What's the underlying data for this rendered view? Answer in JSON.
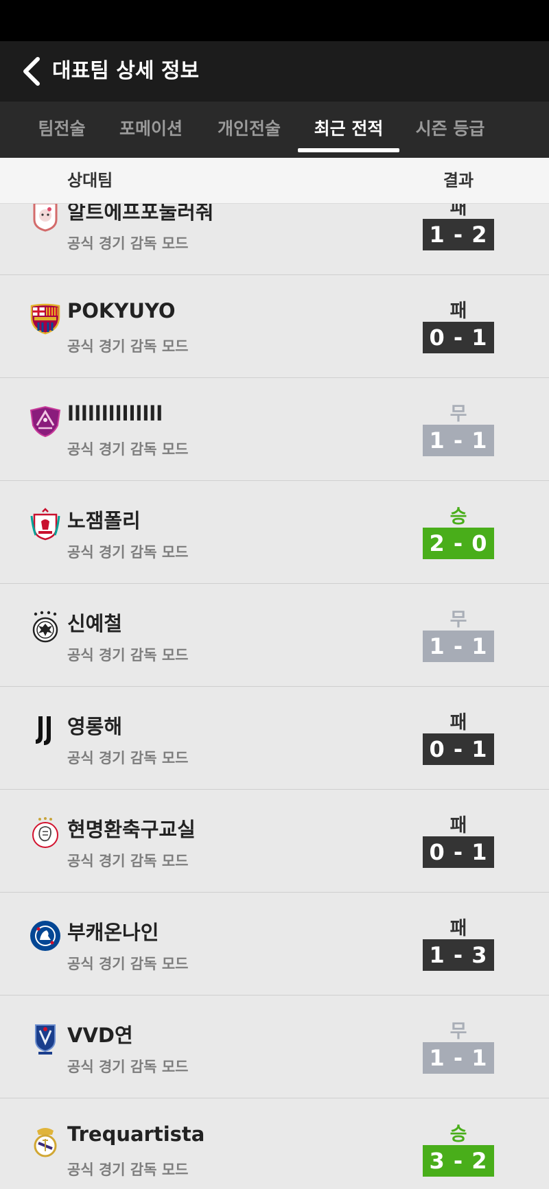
{
  "header": {
    "title": "대표팀 상세 정보"
  },
  "tabs": [
    {
      "label": "팀전술"
    },
    {
      "label": "포메이션"
    },
    {
      "label": "개인전술"
    },
    {
      "label": "최근 전적",
      "active": true
    },
    {
      "label": "시즌 등급"
    }
  ],
  "columns": {
    "opponent": "상대팀",
    "result": "결과"
  },
  "colors": {
    "win": "#49ae1a",
    "draw": "#a7acb6",
    "loss": "#343434"
  },
  "matches": [
    {
      "team": "알트에프포눌러줘",
      "mode": "공식 경기 감독 모드",
      "result": "패",
      "score": "1 - 2",
      "crest": "hello-kitty-crest-icon"
    },
    {
      "team": "POKYUYO",
      "mode": "공식 경기 감독 모드",
      "result": "패",
      "score": "0 - 1",
      "crest": "fc-barcelona-crest-icon"
    },
    {
      "team": "llllllllllllll",
      "mode": "공식 경기 감독 모드",
      "result": "무",
      "score": "1 - 1",
      "crest": "purple-shield-crest-icon"
    },
    {
      "team": "노잼폴리",
      "mode": "공식 경기 감독 모드",
      "result": "승",
      "score": "2 - 0",
      "crest": "liverpool-crest-icon"
    },
    {
      "team": "신예철",
      "mode": "공식 경기 감독 모드",
      "result": "무",
      "score": "1 - 1",
      "crest": "germany-crest-icon"
    },
    {
      "team": "영롱해",
      "mode": "공식 경기 감독 모드",
      "result": "패",
      "score": "0 - 1",
      "crest": "juventus-crest-icon"
    },
    {
      "team": "현명환축구교실",
      "mode": "공식 경기 감독 모드",
      "result": "패",
      "score": "0 - 1",
      "crest": "ajax-crest-icon"
    },
    {
      "team": "부캐온나인",
      "mode": "공식 경기 감독 모드",
      "result": "패",
      "score": "1 - 3",
      "crest": "chelsea-crest-icon"
    },
    {
      "team": "VVD연",
      "mode": "공식 경기 감독 모드",
      "result": "무",
      "score": "1 - 1",
      "crest": "korea-kfa-crest-icon"
    },
    {
      "team": "Trequartista",
      "mode": "공식 경기 감독 모드",
      "result": "승",
      "score": "3 - 2",
      "crest": "real-madrid-crest-icon"
    }
  ]
}
